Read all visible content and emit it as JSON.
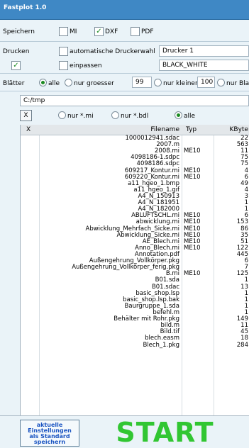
{
  "title": "Fastplot 1.0",
  "speichern": {
    "label": "Speichern",
    "options": [
      {
        "label": "MI",
        "checked": false
      },
      {
        "label": "DXF",
        "checked": true
      },
      {
        "label": "PDF",
        "checked": false
      }
    ]
  },
  "drucken": {
    "label": "Drucken",
    "auto_label": "automatische Druckerwahl",
    "auto_checked": false,
    "printer": "Drucker 1",
    "check_checked": true,
    "einpassen_label": "einpassen",
    "einpassen_checked": false,
    "color_mode": "BLACK_WHITE"
  },
  "blaetter": {
    "label": "Blätter",
    "alle": "alle",
    "groesser": "nur groesser",
    "groesser_value": "99",
    "kleiner": "nur kleiner",
    "kleiner_value": "100",
    "blatt": "nur Blat"
  },
  "path": "C:/tmp",
  "filter": {
    "x_label": "X",
    "mi": "nur *.mi",
    "bdl": "nur *.bdl",
    "alle": "alle"
  },
  "table": {
    "headers": {
      "x": "X",
      "name": "Filename",
      "typ": "Typ",
      "kbyte": "KByte"
    },
    "rows": [
      {
        "name": "1000012941.sdac",
        "typ": "",
        "kb": "22"
      },
      {
        "name": "2007.m",
        "typ": "",
        "kb": "563"
      },
      {
        "name": "2008.mi",
        "typ": "ME10",
        "kb": "11"
      },
      {
        "name": "4098186-1.sdpc",
        "typ": "",
        "kb": "75"
      },
      {
        "name": "4098186.sdpc",
        "typ": "",
        "kb": "75"
      },
      {
        "name": "609217_Kontur.mi",
        "typ": "ME10",
        "kb": "4"
      },
      {
        "name": "609220_Kontur.mi",
        "typ": "ME10",
        "kb": "6"
      },
      {
        "name": "a11_hgeo_1.bmp",
        "typ": "",
        "kb": "49"
      },
      {
        "name": "a11_hgeo_1.gif",
        "typ": "",
        "kb": "4"
      },
      {
        "name": "A4_N_150913",
        "typ": "",
        "kb": "3"
      },
      {
        "name": "A4_N_181951",
        "typ": "",
        "kb": "1"
      },
      {
        "name": "A4_N_182000",
        "typ": "",
        "kb": "1"
      },
      {
        "name": "ABLUFTSCHL.mi",
        "typ": "ME10",
        "kb": "6"
      },
      {
        "name": "abwicklung.mi",
        "typ": "ME10",
        "kb": "153"
      },
      {
        "name": "Abwicklung_Mehrfach_Sicke.mi",
        "typ": "ME10",
        "kb": "86"
      },
      {
        "name": "Abwicklung_Sicke.mi",
        "typ": "ME10",
        "kb": "35"
      },
      {
        "name": "AE_Blech.mi",
        "typ": "ME10",
        "kb": "51"
      },
      {
        "name": "Anno_Blech.mi",
        "typ": "ME10",
        "kb": "122"
      },
      {
        "name": "Annotation.pdf",
        "typ": "",
        "kb": "445"
      },
      {
        "name": "Außengehrung_Vollkörper.pkg",
        "typ": "",
        "kb": "6"
      },
      {
        "name": "Außengehrung_Vollkörper_ferig.pkg",
        "typ": "",
        "kb": "7"
      },
      {
        "name": "B.mi",
        "typ": "ME10",
        "kb": "125"
      },
      {
        "name": "B01.sda",
        "typ": "",
        "kb": "1"
      },
      {
        "name": "B01.sdac",
        "typ": "",
        "kb": "13"
      },
      {
        "name": "basic_shop.lsp",
        "typ": "",
        "kb": "1"
      },
      {
        "name": "basic_shop.lsp.bak",
        "typ": "",
        "kb": "1"
      },
      {
        "name": "Baurgruppe_1.sda",
        "typ": "",
        "kb": "1"
      },
      {
        "name": "befehl.m",
        "typ": "",
        "kb": "1"
      },
      {
        "name": "Behälter mit Rohr.pkg",
        "typ": "",
        "kb": "149"
      },
      {
        "name": "bild.m",
        "typ": "",
        "kb": "11"
      },
      {
        "name": "Bild.tif",
        "typ": "",
        "kb": "45"
      },
      {
        "name": "blech.easm",
        "typ": "",
        "kb": "18"
      },
      {
        "name": "Blech_1.pkg",
        "typ": "",
        "kb": "284"
      }
    ]
  },
  "buttons": {
    "save_line1": "aktuelle",
    "save_line2": "Einstellungen",
    "save_line3": "als Standard",
    "save_line4": "speichern",
    "start": "START"
  }
}
